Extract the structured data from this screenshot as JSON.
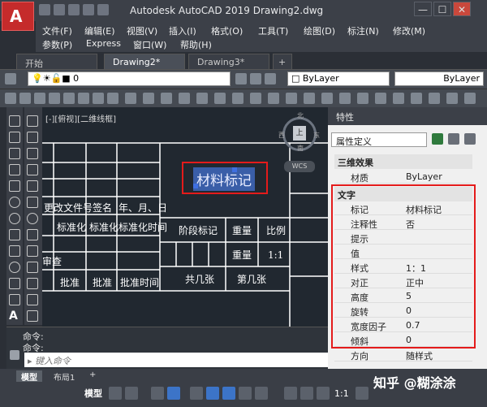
{
  "title": "Autodesk AutoCAD 2019    Drawing2.dwg",
  "app_button": "A",
  "window_buttons": [
    "—",
    "☐",
    "✕"
  ],
  "menu": {
    "row1": [
      "文件(F)",
      "编辑(E)",
      "视图(V)",
      "插入(I)",
      "格式(O)",
      "工具(T)",
      "绘图(D)",
      "标注(N)",
      "修改(M)"
    ],
    "row2": [
      "参数(P)",
      "Express",
      "窗口(W)",
      "帮助(H)"
    ]
  },
  "tabs": [
    "开始",
    "Drawing2*",
    "Drawing3*"
  ],
  "tab_add": "+",
  "layer_value": "0",
  "bylayer": "ByLayer",
  "bylayer_right": "ByLayer",
  "view_label": "[-][俯视][二维线框]",
  "viewcube": {
    "north": "北",
    "south": "南",
    "east": "东",
    "west": "西",
    "center": "上",
    "wcs": "WCS"
  },
  "drawing": {
    "highlight_text": "材料标记",
    "cells_left": [
      "更改文件号",
      "签名",
      "年、月、日",
      "标准化",
      "标准化",
      "标准化时间",
      "审查",
      "批准",
      "批准",
      "批准时间"
    ],
    "cells_right": [
      "阶段标记",
      "重量",
      "比例",
      "重量",
      "1:1",
      "共几张",
      "第几张"
    ]
  },
  "properties": {
    "header": "特性",
    "selector": "属性定义",
    "section_3d": "三维效果",
    "material_label": "材质",
    "material_value": "ByLayer",
    "section_text": "文字",
    "rows": [
      {
        "k": "标记",
        "v": "材料标记"
      },
      {
        "k": "注释性",
        "v": "否"
      },
      {
        "k": "提示",
        "v": ""
      },
      {
        "k": "值",
        "v": ""
      },
      {
        "k": "样式",
        "v": "1：1"
      },
      {
        "k": "对正",
        "v": "正中"
      },
      {
        "k": "高度",
        "v": "5"
      },
      {
        "k": "旋转",
        "v": "0"
      },
      {
        "k": "宽度因子",
        "v": "0.7"
      },
      {
        "k": "倾斜",
        "v": "0"
      },
      {
        "k": "方向",
        "v": "随样式"
      }
    ]
  },
  "command": {
    "line1": "命令:",
    "line2": "命令:",
    "placeholder": "键入命令"
  },
  "layout_tabs": [
    "模型",
    "布局1",
    "+"
  ],
  "status_model": "模型",
  "status_scale": "1:1",
  "watermark": "知乎 @糊涂涂"
}
